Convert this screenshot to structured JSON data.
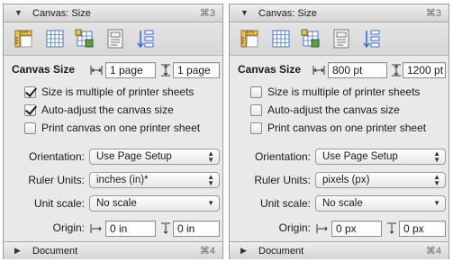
{
  "panels": [
    {
      "header": {
        "title": "Canvas: Size",
        "shortcut": "⌘3"
      },
      "canvas_size": {
        "label": "Canvas Size",
        "width": "1 page",
        "height": "1 page"
      },
      "checkboxes": [
        {
          "label": "Size is multiple of printer sheets",
          "checked": true
        },
        {
          "label": "Auto-adjust the canvas size",
          "checked": true
        },
        {
          "label": "Print canvas on one printer sheet",
          "checked": false
        }
      ],
      "orientation": {
        "label": "Orientation:",
        "value": "Use Page Setup"
      },
      "ruler_units": {
        "label": "Ruler Units:",
        "value": "inches (in)*"
      },
      "unit_scale": {
        "label": "Unit scale:",
        "value": "No scale"
      },
      "origin": {
        "label": "Origin:",
        "x": "0 in",
        "y": "0 in"
      },
      "footer": {
        "title": "Document",
        "shortcut": "⌘4"
      }
    },
    {
      "header": {
        "title": "Canvas: Size",
        "shortcut": "⌘3"
      },
      "canvas_size": {
        "label": "Canvas Size",
        "width": "800 pt",
        "height": "1200 pt"
      },
      "checkboxes": [
        {
          "label": "Size is multiple of printer sheets",
          "checked": false
        },
        {
          "label": "Auto-adjust the canvas size",
          "checked": false
        },
        {
          "label": "Print canvas on one printer sheet",
          "checked": false
        }
      ],
      "orientation": {
        "label": "Orientation:",
        "value": "Use Page Setup"
      },
      "ruler_units": {
        "label": "Ruler Units:",
        "value": "pixels (px)"
      },
      "unit_scale": {
        "label": "Unit scale:",
        "value": "No scale"
      },
      "origin": {
        "label": "Origin:",
        "x": "0 px",
        "y": "0 px"
      },
      "footer": {
        "title": "Document",
        "shortcut": "⌘4"
      }
    }
  ],
  "toolbar_icons": [
    "ruler-icon",
    "grid-icon",
    "alignment-grid-icon",
    "page-layout-icon",
    "layers-icon"
  ],
  "colors": {
    "accent": "#3a6fd8",
    "panel_bg": "#e9e9e9"
  }
}
